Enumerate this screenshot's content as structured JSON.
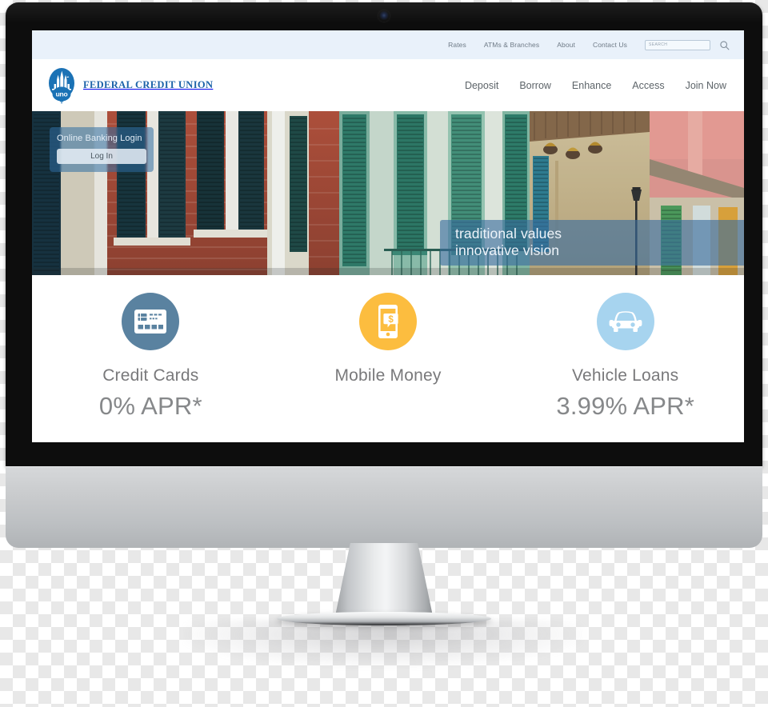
{
  "device": {
    "type": "imac-desktop-monitor",
    "webcam": "webcam-icon"
  },
  "site": {
    "brand_name": "FEDERAL CREDIT UNION",
    "logo_text": "uno",
    "brand_color": "#1b62a8"
  },
  "utility_nav": {
    "links": [
      {
        "label": "Rates"
      },
      {
        "label": "ATMs & Branches"
      },
      {
        "label": "About"
      },
      {
        "label": "Contact Us"
      }
    ],
    "search": {
      "value": "",
      "placeholder": "SEARCH",
      "icon": "search-icon"
    }
  },
  "main_nav": {
    "links": [
      {
        "label": "Deposit"
      },
      {
        "label": "Borrow"
      },
      {
        "label": "Enhance"
      },
      {
        "label": "Access"
      },
      {
        "label": "Join Now"
      }
    ]
  },
  "hero": {
    "login": {
      "title": "Online Banking Login",
      "button_label": "Log In"
    },
    "tagline": {
      "line1": "traditional values",
      "line2": "innovative vision"
    }
  },
  "features": [
    {
      "label": "Credit Cards",
      "rate": "0% APR*",
      "icon": "credit-card-icon",
      "color": "#5a82a0"
    },
    {
      "label": "Mobile Money",
      "rate": "",
      "icon": "mobile-payment-icon",
      "color": "#fcbd3f"
    },
    {
      "label": "Vehicle Loans",
      "rate": "3.99% APR*",
      "icon": "car-icon",
      "color": "#a7d4ef"
    }
  ]
}
